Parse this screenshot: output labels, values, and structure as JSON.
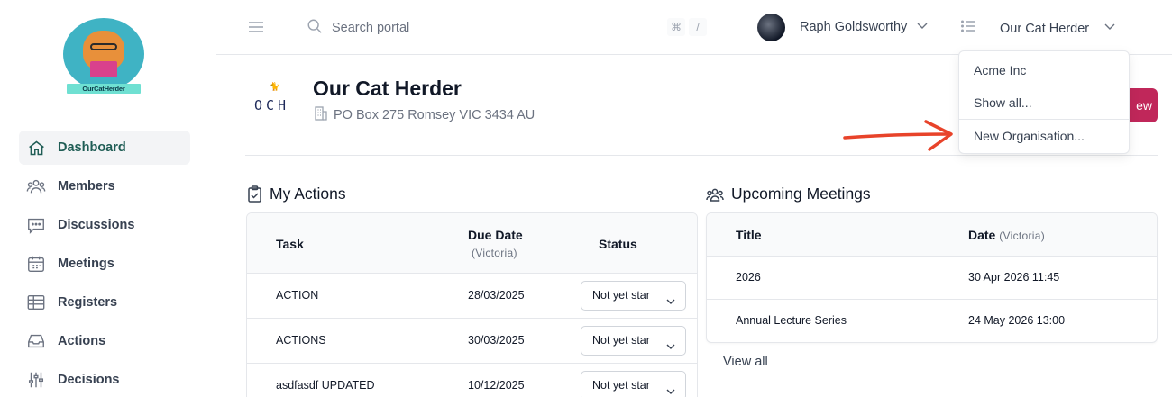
{
  "logo": {
    "banner_text": "OurCatHerder"
  },
  "sidebar": {
    "items": [
      {
        "label": "Dashboard",
        "icon": "home-icon",
        "active": true
      },
      {
        "label": "Members",
        "icon": "users-icon"
      },
      {
        "label": "Discussions",
        "icon": "chat-icon"
      },
      {
        "label": "Meetings",
        "icon": "calendar-icon"
      },
      {
        "label": "Registers",
        "icon": "table-icon"
      },
      {
        "label": "Actions",
        "icon": "inbox-icon"
      },
      {
        "label": "Decisions",
        "icon": "sliders-icon"
      }
    ]
  },
  "topbar": {
    "search_placeholder": "Search portal",
    "shortcut_keys": [
      "⌘",
      "/"
    ],
    "user_name": "Raph Goldsworthy",
    "current_org": "Our Cat Herder"
  },
  "org_dropdown": {
    "items": [
      "Acme Inc",
      "Show all...",
      "New Organisation..."
    ]
  },
  "org": {
    "logo_text": "OCH",
    "name": "Our Cat Herder",
    "address": "PO Box 275 Romsey VIC 3434 AU",
    "new_button_label": "ew"
  },
  "my_actions": {
    "title": "My Actions",
    "columns": {
      "task": "Task",
      "due_date": "Due Date",
      "due_date_tz": "(Victoria)",
      "status": "Status"
    },
    "rows": [
      {
        "task": "ACTION",
        "due": "28/03/2025",
        "status": "Not yet star"
      },
      {
        "task": "ACTIONS",
        "due": "30/03/2025",
        "status": "Not yet star"
      },
      {
        "task": "asdfasdf UPDATED",
        "due": "10/12/2025",
        "status": "Not yet star"
      }
    ]
  },
  "upcoming_meetings": {
    "title": "Upcoming Meetings",
    "columns": {
      "title": "Title",
      "date": "Date",
      "date_tz": "(Victoria)"
    },
    "rows": [
      {
        "title": "2026",
        "date": "30 Apr 2026 11:45"
      },
      {
        "title": "Annual Lecture Series",
        "date": "24 May 2026 13:00"
      }
    ],
    "view_all": "View all"
  },
  "colors": {
    "accent": "#c0275a",
    "arrow": "#e8432a",
    "active_nav": "#1f5d55"
  }
}
